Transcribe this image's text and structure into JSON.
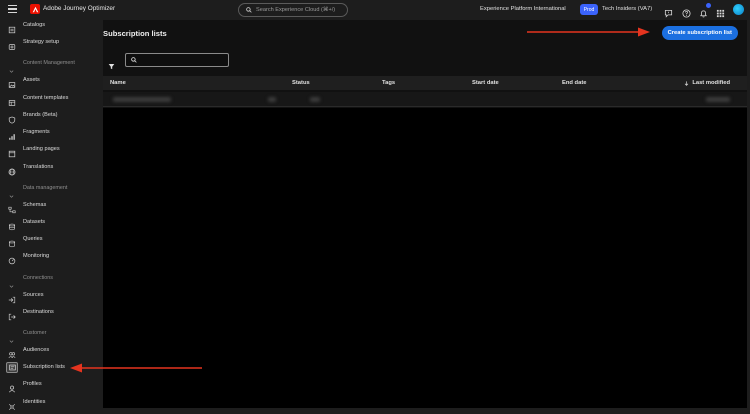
{
  "topbar": {
    "app_title": "Adobe Journey Optimizer",
    "search_placeholder": "Search Experience Cloud (⌘+/)",
    "org_name": "Experience Platform International",
    "env_badge": "Prod",
    "sandbox_name": "Tech Insiders (VA7)",
    "icons": [
      "feedback-icon",
      "help-icon",
      "notifications-icon",
      "apps-grid-icon"
    ],
    "notification_count": "1"
  },
  "sidebar": {
    "items_top": [
      {
        "label": "Catalogs",
        "icon": "catalog-icon"
      },
      {
        "label": "Strategy setup",
        "icon": "strategy-icon"
      }
    ],
    "content_management": {
      "header": "Content Management",
      "items": [
        {
          "label": "Assets",
          "icon": "assets-icon"
        },
        {
          "label": "Content templates",
          "icon": "templates-icon"
        },
        {
          "label": "Brands (Beta)",
          "icon": "brands-icon"
        },
        {
          "label": "Fragments",
          "icon": "fragments-icon"
        },
        {
          "label": "Landing pages",
          "icon": "landing-pages-icon"
        },
        {
          "label": "Translations",
          "icon": "translations-icon"
        }
      ]
    },
    "data_management": {
      "header": "Data management",
      "items": [
        {
          "label": "Schemas",
          "icon": "schemas-icon"
        },
        {
          "label": "Datasets",
          "icon": "datasets-icon"
        },
        {
          "label": "Queries",
          "icon": "queries-icon"
        },
        {
          "label": "Monitoring",
          "icon": "monitoring-icon"
        }
      ]
    },
    "connections": {
      "header": "Connections",
      "items": [
        {
          "label": "Sources",
          "icon": "sources-icon"
        },
        {
          "label": "Destinations",
          "icon": "destinations-icon"
        }
      ]
    },
    "customer": {
      "header": "Customer",
      "items": [
        {
          "label": "Audiences",
          "icon": "audiences-icon"
        },
        {
          "label": "Subscription lists",
          "icon": "subscription-lists-icon"
        },
        {
          "label": "Profiles",
          "icon": "profiles-icon"
        },
        {
          "label": "Identities",
          "icon": "identities-icon"
        }
      ]
    },
    "active_item": "Subscription lists"
  },
  "main": {
    "title": "Subscription lists",
    "create_button": "Create subscription list",
    "search_value": "",
    "columns": [
      "Name",
      "Status",
      "Tags",
      "Start date",
      "End date",
      "Last modified"
    ],
    "sort_column": "Last modified",
    "sort_direction": "descending"
  },
  "colors": {
    "accent": "#1b6fe0",
    "annotation_arrow": "#e5341f",
    "adobe_red": "#eb1000",
    "prod_badge": "#3b63fb"
  }
}
